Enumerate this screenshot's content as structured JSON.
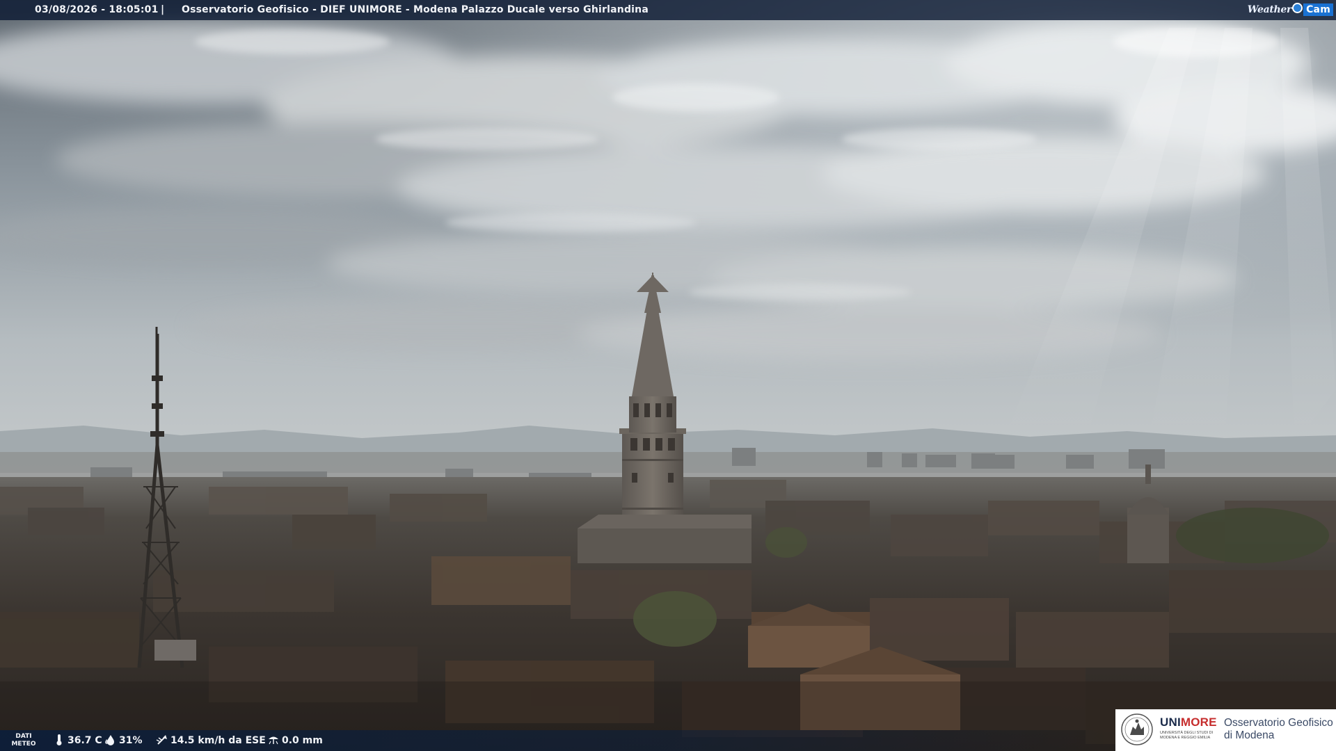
{
  "webcam": {
    "timestamp": "03/08/2026 - 18:05:01",
    "separator": "|",
    "caption": "Osservatorio Geofisico - DIEF UNIMORE - Modena Palazzo Ducale verso Ghirlandina",
    "brand": {
      "weather": "Weather",
      "cam": "Cam"
    }
  },
  "weather_data": {
    "label_line1": "DATI",
    "label_line2": "METEO",
    "temperature": "36.7 C",
    "humidity": "31%",
    "wind": "14.5 km/h da ESE",
    "rain": "0.0 mm"
  },
  "logo": {
    "uni_part1": "UNI",
    "uni_part2": "MORE",
    "uni_sub": "UNIVERSITÀ DEGLI STUDI DI MODENA E REGGIO EMILIA",
    "obs_line1": "Osservatorio Geofisico",
    "obs_line2": "di Modena"
  },
  "icons": {
    "temperature": "thermometer-icon",
    "humidity": "droplet-icon",
    "wind": "wind-icon",
    "rain": "rain-icon"
  },
  "colors": {
    "overlay_bar": "#081630",
    "brand_blue": "#1a72d3",
    "unimore_red": "#c62d2d"
  }
}
